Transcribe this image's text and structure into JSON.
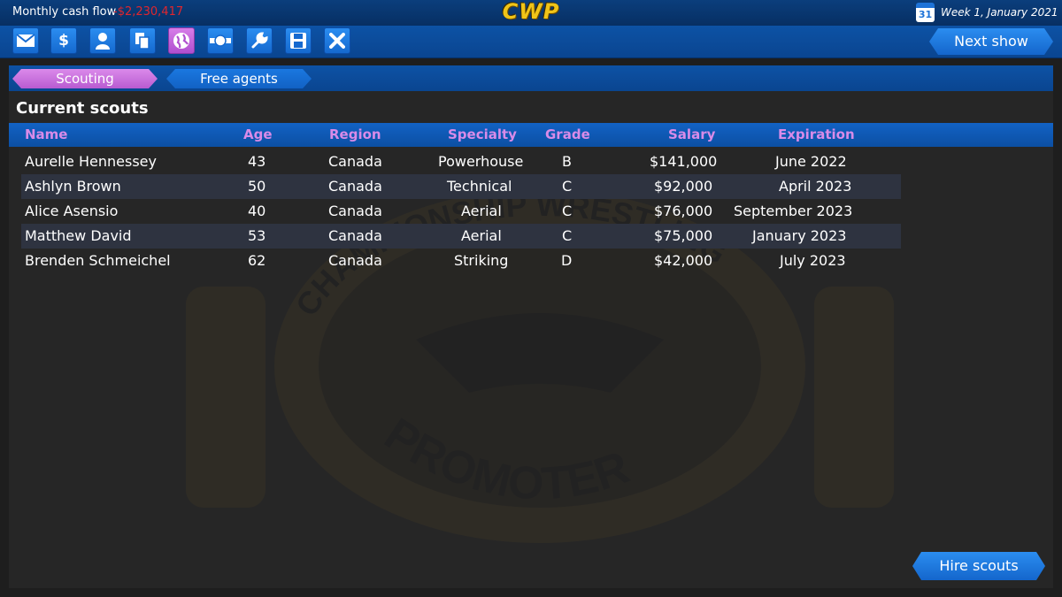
{
  "topbar": {
    "cash_label": "Monthly cash flow",
    "cash_value": "-$2,230,417",
    "logo": "CWP",
    "calendar_day": "31",
    "date": "Week 1, January 2021"
  },
  "toolbar": {
    "icons": [
      "mail-icon",
      "dollar-icon",
      "person-icon",
      "documents-icon",
      "globe-icon",
      "belt-icon",
      "wrench-icon",
      "save-icon",
      "close-icon"
    ],
    "next_show": "Next show"
  },
  "tabs": {
    "scouting": "Scouting",
    "free_agents": "Free agents"
  },
  "section_title": "Current scouts",
  "table": {
    "headers": {
      "name": "Name",
      "age": "Age",
      "region": "Region",
      "specialty": "Specialty",
      "grade": "Grade",
      "salary": "Salary",
      "expiration": "Expiration"
    },
    "rows": [
      {
        "name": "Aurelle Hennessey",
        "age": "43",
        "region": "Canada",
        "specialty": "Powerhouse",
        "grade": "B",
        "salary": "$141,000",
        "expiration": "June 2022"
      },
      {
        "name": "Ashlyn Brown",
        "age": "50",
        "region": "Canada",
        "specialty": "Technical",
        "grade": "C",
        "salary": "$92,000",
        "expiration": "April 2023"
      },
      {
        "name": "Alice Asensio",
        "age": "40",
        "region": "Canada",
        "specialty": "Aerial",
        "grade": "C",
        "salary": "$76,000",
        "expiration": "September 2023"
      },
      {
        "name": "Matthew David",
        "age": "53",
        "region": "Canada",
        "specialty": "Aerial",
        "grade": "C",
        "salary": "$75,000",
        "expiration": "January 2023"
      },
      {
        "name": "Brenden Schmeichel",
        "age": "62",
        "region": "Canada",
        "specialty": "Striking",
        "grade": "D",
        "salary": "$42,000",
        "expiration": "July 2023"
      }
    ]
  },
  "hire_button": "Hire scouts",
  "watermark": {
    "top_text": "CHAMPIONSHIP WRESTLING",
    "bottom_text": "PROMOTER"
  }
}
